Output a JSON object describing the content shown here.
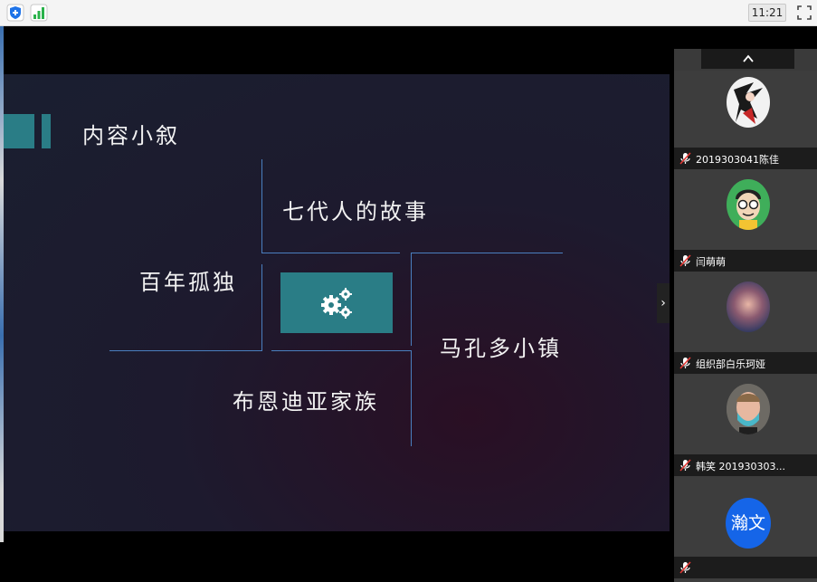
{
  "toolbar": {
    "clock": "11:21",
    "icons": [
      "shield-icon",
      "signal-icon",
      "fullscreen-icon"
    ]
  },
  "slide": {
    "title": "内容小叙",
    "items": [
      "七代人的故事",
      "百年孤独",
      "马孔多小镇",
      "布恩迪亚家族"
    ],
    "accent_color": "#2a7d86",
    "line_color": "#4a7fbf",
    "icon": "gears-icon"
  },
  "participants": [
    {
      "name": "2019303041陈佳",
      "muted": true
    },
    {
      "name": "闫萌萌",
      "muted": true
    },
    {
      "name": "组织部白乐珂娅",
      "muted": true
    },
    {
      "name": "韩笑   201930303...",
      "muted": true
    },
    {
      "name": "",
      "avatar_text": "瀚文",
      "muted": true
    }
  ],
  "sidebar": {
    "scroll_up_icon": "chevron-up-icon",
    "collapse_icon": "chevron-right-icon"
  }
}
